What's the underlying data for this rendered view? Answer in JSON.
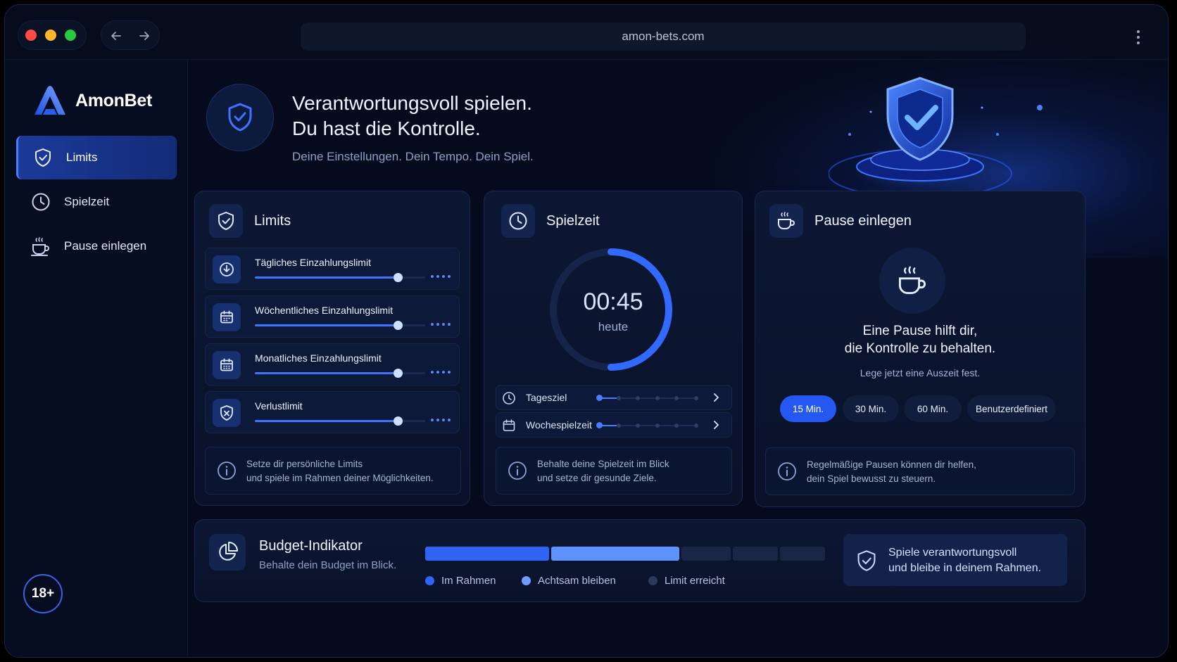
{
  "browser": {
    "url": "amon-bets.com"
  },
  "brand": {
    "name": "AmonBet"
  },
  "sidebar": {
    "items": [
      {
        "label": "Limits",
        "icon": "shield-check-icon",
        "active": true
      },
      {
        "label": "Spielzeit",
        "icon": "clock-icon",
        "active": false
      },
      {
        "label": "Pause einlegen",
        "icon": "coffee-cup-icon",
        "active": false
      }
    ],
    "age_badge": "18+"
  },
  "hero": {
    "title_line1": "Verantwortungsvoll spielen.",
    "title_line2": "Du hast die Kontrolle.",
    "subtitle": "Deine Einstellungen. Dein Tempo. Dein Spiel."
  },
  "limits_card": {
    "title": "Limits",
    "rows": [
      {
        "label": "Tägliches Einzahlungslimit",
        "icon": "download-circle-icon",
        "level": 0.84
      },
      {
        "label": "Wöchentliches Einzahlungslimit",
        "icon": "calendar-icon",
        "level": 0.84
      },
      {
        "label": "Monatliches Einzahlungslimit",
        "icon": "calendar-icon",
        "level": 0.84
      },
      {
        "label": "Verlustlimit",
        "icon": "shield-x-icon",
        "level": 0.84
      }
    ],
    "info_line1": "Setze dir persönliche Limits",
    "info_line2": "und spiele im Rahmen deiner Möglichkeiten."
  },
  "playtime_card": {
    "title": "Spielzeit",
    "timer": "00:45",
    "timer_caption": "heute",
    "ring_progress": 0.5,
    "goals": [
      {
        "label": "Tagesziel",
        "icon": "clock-icon",
        "level": 0
      },
      {
        "label": "Wochespielzeit",
        "icon": "calendar-icon",
        "level": 0
      }
    ],
    "info_line1": "Behalte deine Spielzeit im Blick",
    "info_line2": "und setze dir gesunde Ziele."
  },
  "pause_card": {
    "title": "Pause einlegen",
    "headline_line1": "Eine Pause hilft dir,",
    "headline_line2": "die Kontrolle zu behalten.",
    "caption": "Lege jetzt eine Auszeit fest.",
    "options": [
      {
        "label": "15 Min.",
        "selected": true
      },
      {
        "label": "30 Min.",
        "selected": false
      },
      {
        "label": "60 Min.",
        "selected": false
      },
      {
        "label": "Benutzerdefiniert",
        "selected": false
      }
    ],
    "info_line1": "Regelmäßige Pausen können dir helfen,",
    "info_line2": "dein Spiel bewusst zu steuern."
  },
  "budget": {
    "title": "Budget-Indikator",
    "subtitle": "Behalte dein Budget im Blick.",
    "segments": [
      {
        "state": "Im Rahmen",
        "color": "#2f64f5"
      },
      {
        "state": "Achtsam bleiben",
        "color": "#5c93ff"
      },
      {
        "state": "Limit erreicht",
        "color": "#1a2645"
      }
    ],
    "legend": [
      {
        "label": "Im Rahmen",
        "color": "#2f64f5"
      },
      {
        "label": "Achtsam bleiben",
        "color": "#6f9cff"
      },
      {
        "label": "Limit erreicht",
        "color": "#2c3a5e"
      }
    ],
    "callout_line1": "Spiele verantwortungsvoll",
    "callout_line2": "und bleibe in deinem Rahmen."
  },
  "colors": {
    "accent": "#2f64f5",
    "background": "#050b1d",
    "card": "#0c1733"
  }
}
